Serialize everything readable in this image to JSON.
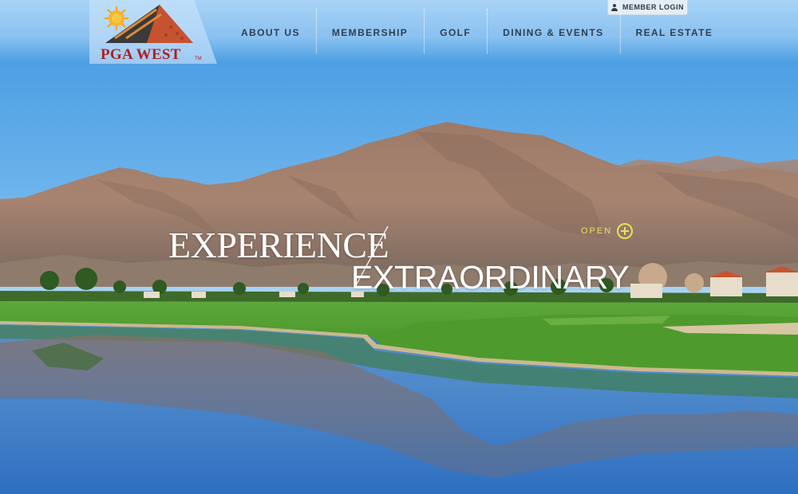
{
  "brand": {
    "name": "PGA WEST",
    "trademark": "TM"
  },
  "header": {
    "member_login_label": "MEMBER LOGIN",
    "nav": [
      {
        "label": "ABOUT US"
      },
      {
        "label": "MEMBERSHIP"
      },
      {
        "label": "GOLF"
      },
      {
        "label": "DINING & EVENTS"
      },
      {
        "label": "REAL ESTATE"
      }
    ]
  },
  "hero": {
    "line1": "EXPERIENCE",
    "line2": "EXTRAORDINARY",
    "open_label": "OPEN"
  },
  "icons": {
    "user": "user-icon",
    "open": "plus-circle-icon",
    "logo": "pga-west-logo"
  },
  "colors": {
    "brand_red": "#b31d20",
    "nav_text": "#2f3f52",
    "open_accent": "#e8e25a",
    "sky": "#5aa5e6"
  }
}
